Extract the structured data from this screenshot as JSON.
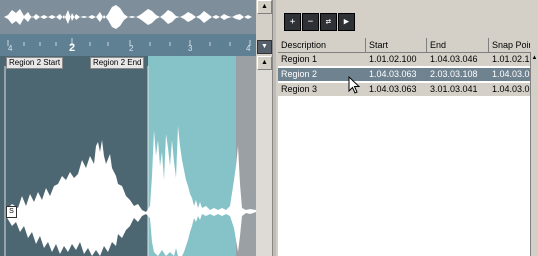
{
  "editor": {
    "ruler_ticks": [
      {
        "label": "4",
        "bold": false
      },
      {
        "label": "2",
        "bold": true
      },
      {
        "label": "2",
        "bold": false
      },
      {
        "label": "3",
        "bold": false
      },
      {
        "label": "4",
        "bold": false
      }
    ],
    "region_start_label": "Region 2 Start",
    "region_end_label": "Region 2 End",
    "s_marker": "S"
  },
  "region_list": {
    "toolbar_buttons": [
      {
        "name": "add-region-icon",
        "glyph": "+"
      },
      {
        "name": "remove-region-icon",
        "glyph": "−"
      },
      {
        "name": "select-in-event-icon",
        "glyph": "⇄"
      },
      {
        "name": "play-region-icon",
        "glyph": "▶"
      }
    ],
    "columns": [
      "Description",
      "Start",
      "End",
      "Snap Point"
    ],
    "rows": [
      {
        "description": "Region 1",
        "start": "1.01.02.100",
        "end": "1.04.03.046",
        "snap": "1.01.02.1",
        "selected": false
      },
      {
        "description": "Region 2",
        "start": "1.04.03.063",
        "end": "2.03.03.108",
        "snap": "1.04.03.0",
        "selected": true
      },
      {
        "description": "Region 3",
        "start": "1.04.03.063",
        "end": "3.01.03.041",
        "snap": "1.04.03.0",
        "selected": false
      }
    ]
  },
  "colors": {
    "waveform_bg": "#4c6672",
    "region_highlight": "#86c3c8",
    "selected_row": "#6f8290",
    "panel_gray": "#d4d0c8"
  }
}
